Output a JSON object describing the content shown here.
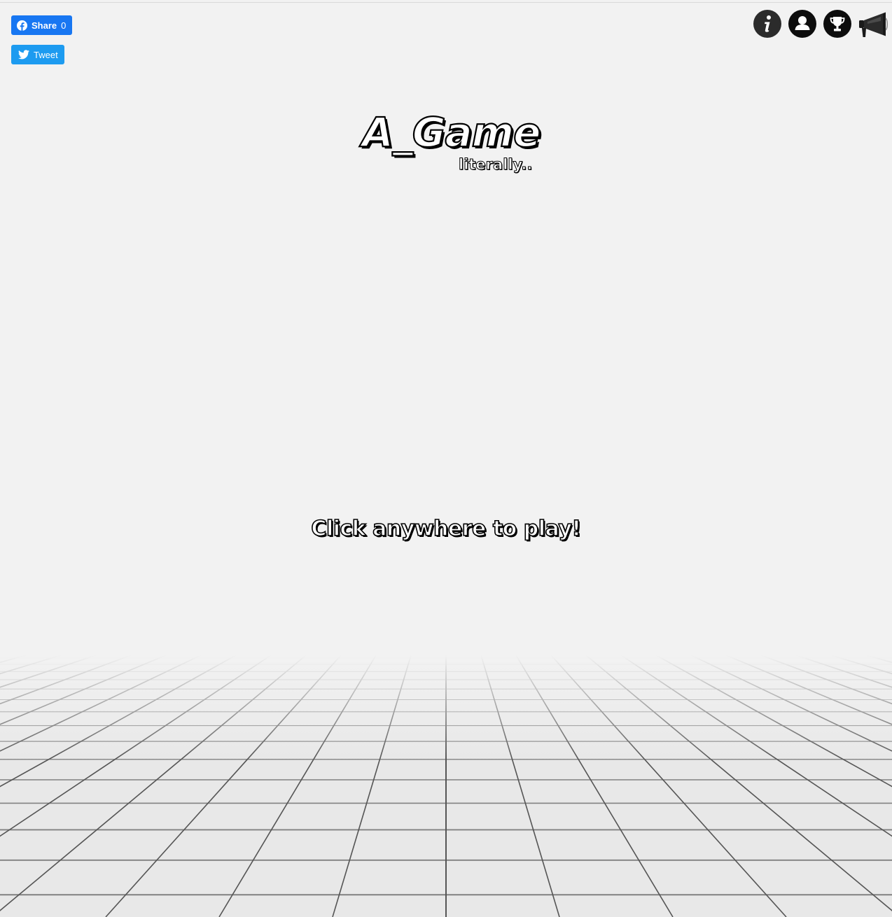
{
  "share": {
    "facebook_label": "Share",
    "facebook_count": "0",
    "twitter_label": "Tweet"
  },
  "toolbar": {
    "info_icon": "info-icon",
    "profile_icon": "user-icon",
    "leaderboard_icon": "trophy-icon",
    "announce_icon": "megaphone-icon"
  },
  "logo": {
    "title": "A_Game",
    "subtitle": "literally.."
  },
  "prompt": {
    "text": "Click anywhere to play!"
  },
  "colors": {
    "background": "#f2f2f2",
    "facebook": "#1877f2",
    "twitter": "#1d9bf0",
    "floor_tile": "#e8e8e8",
    "grid_line": "#555555"
  }
}
